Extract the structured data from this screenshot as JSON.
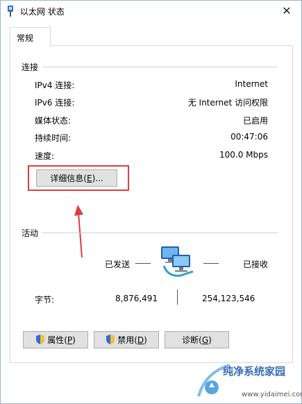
{
  "window": {
    "title": "以太网 状态",
    "close": "✕"
  },
  "tabs": [
    {
      "label": "常规"
    }
  ],
  "connection": {
    "section_title": "连接",
    "rows": [
      {
        "label": "IPv4 连接:",
        "value": "Internet"
      },
      {
        "label": "IPv6 连接:",
        "value": "无 Internet 访问权限"
      },
      {
        "label": "媒体状态:",
        "value": "已启用"
      },
      {
        "label": "持续时间:",
        "value": "00:47:06"
      },
      {
        "label": "速度:",
        "value": "100.0 Mbps"
      }
    ],
    "details_button": {
      "text": "详细信息(",
      "key": "E",
      "suffix": ")..."
    }
  },
  "activity": {
    "section_title": "活动",
    "sent_label": "已发送",
    "received_label": "已接收",
    "bytes_label": "字节:",
    "bytes_sent": "8,876,491",
    "bytes_received": "254,123,546"
  },
  "buttons": {
    "properties": {
      "text": "属性(",
      "key": "P",
      "suffix": ")"
    },
    "disable": {
      "text": "禁用(",
      "key": "D",
      "suffix": ")"
    },
    "diagnose": {
      "text": "诊断(",
      "key": "G",
      "suffix": ")"
    }
  },
  "watermark": {
    "brand": "纯净系统家园",
    "url": "www.yidaimei.com"
  },
  "colors": {
    "highlight": "#e03c3c",
    "arrow": "#e03c3c",
    "shield_blue": "#2f6fcf",
    "shield_yellow": "#f2c230"
  }
}
